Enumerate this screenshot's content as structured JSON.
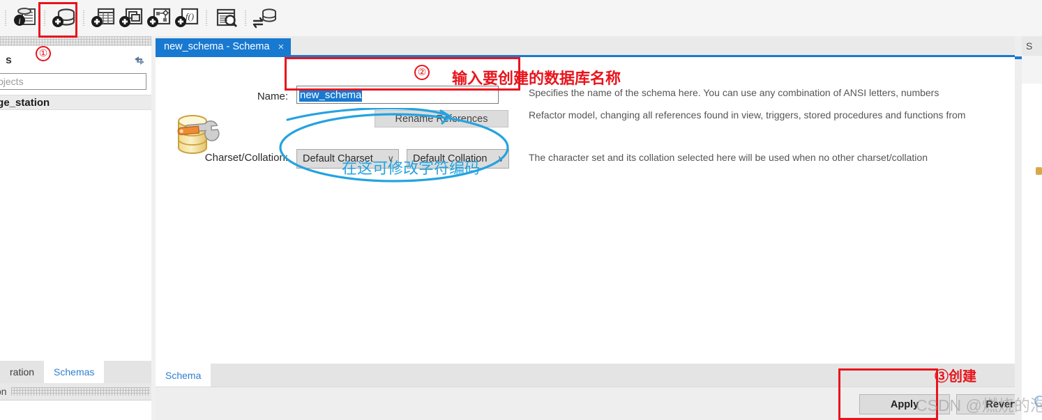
{
  "toolbar": {
    "icons": [
      {
        "name": "new-model-info-icon",
        "title": "New Model"
      },
      {
        "name": "add-schema-icon",
        "title": "Create New Schema"
      },
      {
        "name": "add-table-icon",
        "title": "Create New Table"
      },
      {
        "name": "add-view-icon",
        "title": "Create New View"
      },
      {
        "name": "add-routine-group-icon",
        "title": "Create New Routine Group"
      },
      {
        "name": "add-function-icon",
        "title": "Create New Function"
      },
      {
        "name": "inspect-schema-icon",
        "title": "Inspect Schema"
      },
      {
        "name": "sync-model-icon",
        "title": "Synchronize Model"
      }
    ]
  },
  "sidebar": {
    "title": "s",
    "refresh_icon": "refresh-icon",
    "search_placeholder": "bjects",
    "selected_item": "arge_station",
    "second_item": "s",
    "tabs": [
      {
        "label": "ration",
        "active": false
      },
      {
        "label": "Schemas",
        "active": true
      }
    ],
    "status": "on"
  },
  "editor": {
    "tab_title": "new_schema - Schema",
    "tab_close": "×",
    "icon_name": "schema-database-wrench-icon",
    "name_label": "Name:",
    "name_value": "new_schema",
    "rename_button": "Rename References",
    "charset_label": "Charset/Collation:",
    "charset_value": "Default Charset",
    "collation_value": "Default Collation",
    "chevron": "∨",
    "help_name": "Specifies the name of the schema here. You can use any combination of ANSI letters, numbers",
    "help_rename": "Refactor model, changing all references found in view, triggers, stored procedures and functions from",
    "help_charset": "The character set and its collation selected here will be used when no other charset/collation",
    "bottom_tabs": [
      {
        "label": "Schema",
        "active": true
      }
    ],
    "apply_button": "Apply",
    "revert_button": "Revert"
  },
  "right_panel": {
    "header": "S"
  },
  "annotations": {
    "step1_number": "①",
    "step2_number": "②",
    "step2_text": "输入要创建的数据库名称",
    "step3_text": "③创建",
    "charset_text": "在这可修改字符编码",
    "red_color": "#e8141c",
    "blue_color": "#24a3e0"
  },
  "watermark": {
    "text": "CSDN @燃烧的泡菜",
    "trailing": "C"
  }
}
